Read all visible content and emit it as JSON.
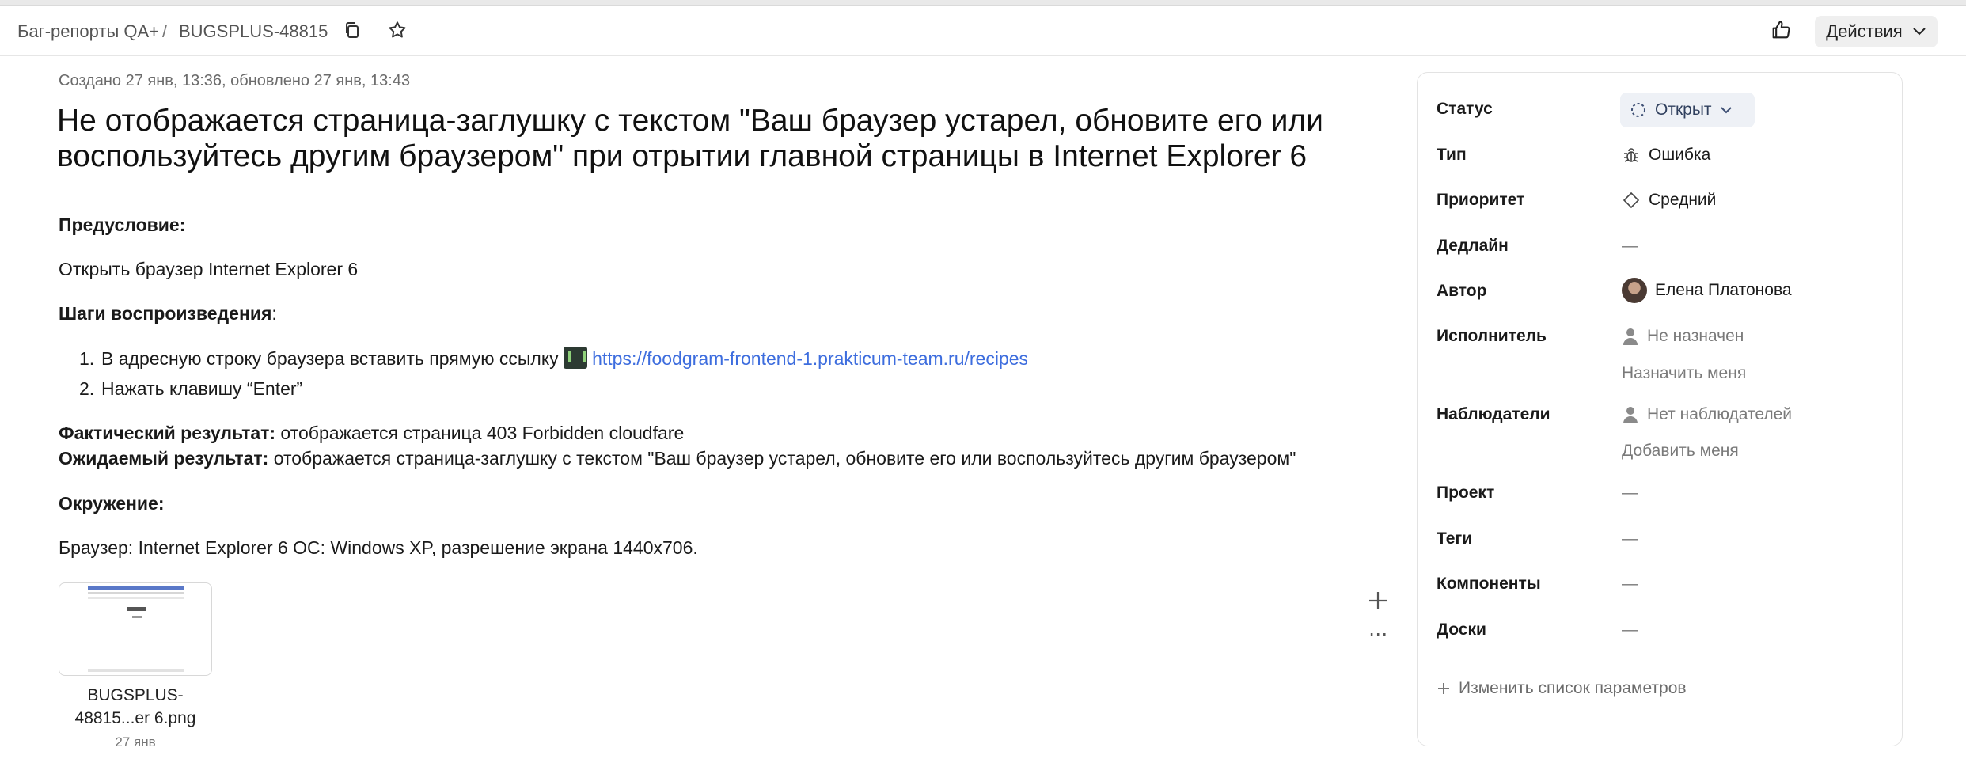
{
  "header": {
    "breadcrumb_queue": "Баг-репорты QA+",
    "breadcrumb_sep": "/",
    "breadcrumb_key": "BUGSPLUS-48815",
    "actions_label": "Действия"
  },
  "issue": {
    "meta": "Создано 27 янв, 13:36, обновлено 27 янв, 13:43",
    "title": "Не отображается страница-заглушку с текстом \"Ваш браузер устарел, обновите его или воспользуйтесь другим браузером\" при отрытии главной страницы в Internet Explorer 6",
    "precondition_heading": "Предусловие:",
    "precondition_text": "Открыть браузер Internet Explorer 6",
    "steps_heading": "Шаги воспроизведения",
    "steps_colon": ":",
    "step1_num": "1.",
    "step1_text": "В адресную строку браузера вставить прямую ссылку",
    "step1_link": "https://foodgram-frontend-1.prakticum-team.ru/recipes",
    "step2_num": "2.",
    "step2_text": "Нажать клавишу “Enter”",
    "actual_label": "Фактический результат:",
    "actual_text": " отображается страница 403 Forbidden cloudfare",
    "expected_label": "Ожидаемый результат:",
    "expected_text": " отображается страница-заглушку с текстом \"Ваш браузер устарел, обновите его или воспользуйтесь другим браузером\"",
    "env_heading": "Окружение:",
    "env_text": "Браузер: Internet Explorer 6 ОС: Windows XP, разрешение экрана 1440x706."
  },
  "attachment": {
    "name_line1": "BUGSPLUS-",
    "name_line2": "48815...er 6.png",
    "date": "27 янв"
  },
  "panel": {
    "status_label": "Статус",
    "status_value": "Открыт",
    "type_label": "Тип",
    "type_value": "Ошибка",
    "priority_label": "Приоритет",
    "priority_value": "Средний",
    "deadline_label": "Дедлайн",
    "deadline_value": "—",
    "author_label": "Автор",
    "author_value": "Елена Платонова",
    "assignee_label": "Исполнитель",
    "assignee_value": "Не назначен",
    "assign_me": "Назначить меня",
    "followers_label": "Наблюдатели",
    "followers_value": "Нет наблюдателей",
    "add_me": "Добавить меня",
    "project_label": "Проект",
    "project_value": "—",
    "tags_label": "Теги",
    "tags_value": "—",
    "components_label": "Компоненты",
    "components_value": "—",
    "boards_label": "Доски",
    "boards_value": "—",
    "change_params": "Изменить список параметров"
  },
  "colors": {
    "link": "#3d6dde",
    "status_bg": "#eef1f6",
    "status_text": "#30405e"
  },
  "icons": [
    "copy-icon",
    "star-icon",
    "thumbs-up-icon",
    "chevron-down-icon",
    "bug-icon",
    "diamond-icon",
    "person-icon",
    "plus-icon",
    "more-icon",
    "status-circle-icon"
  ]
}
